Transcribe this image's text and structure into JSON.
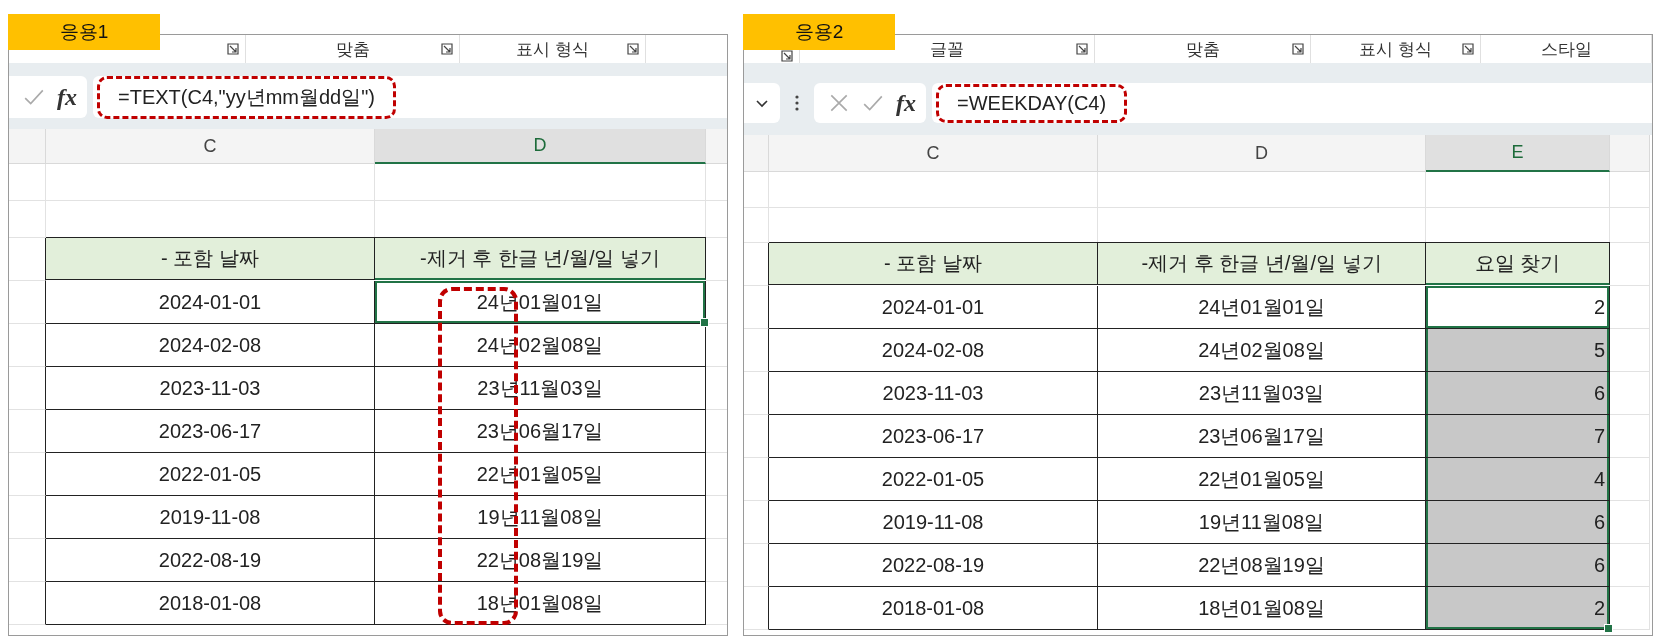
{
  "panels": [
    {
      "badge": "응용1",
      "ribbon_groups": [
        {
          "label": "맞춤"
        },
        {
          "label": "표시 형식"
        }
      ],
      "formula_bar": {
        "icons": [
          {
            "kind": "enter"
          }
        ],
        "fx": "fx",
        "formula": "=TEXT(C4,\"yy년mm월dd일\")",
        "highlighted": true
      },
      "column_headers": [
        {
          "label": "C",
          "selected": false
        },
        {
          "label": "D",
          "selected": true
        }
      ],
      "column_highlight": true,
      "table": {
        "columns": [
          {
            "label": "- 포함 날짜",
            "kind": "text"
          },
          {
            "label": "-제거 후 한글 년/월/일 넣기",
            "kind": "text"
          }
        ],
        "rows": [
          [
            {
              "text": "2024-01-01",
              "selected": false,
              "active": false
            },
            {
              "text": "24년01월01일",
              "selected": true,
              "active": true
            }
          ],
          [
            {
              "text": "2024-02-08",
              "selected": false,
              "active": false
            },
            {
              "text": "24년02월08일",
              "selected": false,
              "active": false
            }
          ],
          [
            {
              "text": "2023-11-03",
              "selected": false,
              "active": false
            },
            {
              "text": "23년11월03일",
              "selected": false,
              "active": false
            }
          ],
          [
            {
              "text": "2023-06-17",
              "selected": false,
              "active": false
            },
            {
              "text": "23년06월17일",
              "selected": false,
              "active": false
            }
          ],
          [
            {
              "text": "2022-01-05",
              "selected": false,
              "active": false
            },
            {
              "text": "22년01월05일",
              "selected": false,
              "active": false
            }
          ],
          [
            {
              "text": "2019-11-08",
              "selected": false,
              "active": false
            },
            {
              "text": "19년11월08일",
              "selected": false,
              "active": false
            }
          ],
          [
            {
              "text": "2022-08-19",
              "selected": false,
              "active": false
            },
            {
              "text": "22년08월19일",
              "selected": false,
              "active": false
            }
          ],
          [
            {
              "text": "2018-01-08",
              "selected": false,
              "active": false
            },
            {
              "text": "18년01월08일",
              "selected": false,
              "active": false
            }
          ]
        ]
      }
    },
    {
      "badge": "응용2",
      "ribbon_groups": [
        {
          "label": "글꼴"
        },
        {
          "label": "맞춤"
        },
        {
          "label": "표시 형식"
        },
        {
          "label": "스타일"
        }
      ],
      "formula_bar": {
        "icons": [
          {
            "kind": "dropdown"
          },
          {
            "kind": "more"
          },
          {
            "kind": "cancel"
          },
          {
            "kind": "enter"
          }
        ],
        "fx": "fx",
        "formula": "=WEEKDAY(C4)",
        "highlighted": true
      },
      "column_headers": [
        {
          "label": "C",
          "selected": false
        },
        {
          "label": "D",
          "selected": false
        },
        {
          "label": "E",
          "selected": true
        }
      ],
      "table": {
        "columns": [
          {
            "label": "- 포함 날짜",
            "kind": "text"
          },
          {
            "label": "-제거 후 한글 년/월/일 넣기",
            "kind": "text"
          },
          {
            "label": "요일 찾기",
            "kind": "number"
          }
        ],
        "rows": [
          [
            {
              "text": "2024-01-01",
              "selected": false,
              "active": false
            },
            {
              "text": "24년01월01일",
              "selected": false,
              "active": false
            },
            {
              "text": "2",
              "selected": true,
              "active": true
            }
          ],
          [
            {
              "text": "2024-02-08",
              "selected": false,
              "active": false
            },
            {
              "text": "24년02월08일",
              "selected": false,
              "active": false
            },
            {
              "text": "5",
              "selected": true,
              "active": false
            }
          ],
          [
            {
              "text": "2023-11-03",
              "selected": false,
              "active": false
            },
            {
              "text": "23년11월03일",
              "selected": false,
              "active": false
            },
            {
              "text": "6",
              "selected": true,
              "active": false
            }
          ],
          [
            {
              "text": "2023-06-17",
              "selected": false,
              "active": false
            },
            {
              "text": "23년06월17일",
              "selected": false,
              "active": false
            },
            {
              "text": "7",
              "selected": true,
              "active": false
            }
          ],
          [
            {
              "text": "2022-01-05",
              "selected": false,
              "active": false
            },
            {
              "text": "22년01월05일",
              "selected": false,
              "active": false
            },
            {
              "text": "4",
              "selected": true,
              "active": false
            }
          ],
          [
            {
              "text": "2019-11-08",
              "selected": false,
              "active": false
            },
            {
              "text": "19년11월08일",
              "selected": false,
              "active": false
            },
            {
              "text": "6",
              "selected": true,
              "active": false
            }
          ],
          [
            {
              "text": "2022-08-19",
              "selected": false,
              "active": false
            },
            {
              "text": "22년08월19일",
              "selected": false,
              "active": false
            },
            {
              "text": "6",
              "selected": true,
              "active": false
            }
          ],
          [
            {
              "text": "2018-01-08",
              "selected": false,
              "active": false
            },
            {
              "text": "18년01월08일",
              "selected": false,
              "active": false
            },
            {
              "text": "2",
              "selected": true,
              "active": false
            }
          ]
        ]
      }
    }
  ]
}
